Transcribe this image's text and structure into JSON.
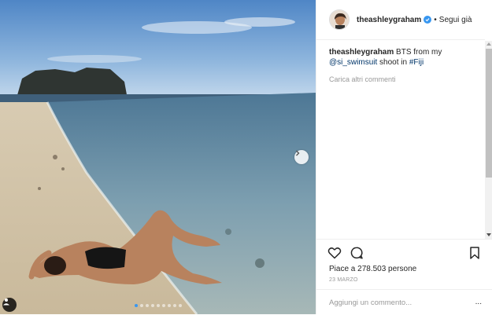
{
  "post": {
    "username": "theashleygraham",
    "separator": "•",
    "follow_label": "Segui già",
    "caption": {
      "username": "theashleygraham",
      "text_before": " BTS from my ",
      "mention": "@si_swimsuit",
      "text_middle": " shoot in ",
      "hashtag": "#Fiji"
    },
    "load_more_label": "Carica altri commenti",
    "likes_text": "Piace a 278.503 persone",
    "date_text": "23 MARZO",
    "comment_placeholder": "Aggiungi un commento...",
    "more_label": "...",
    "carousel": {
      "total": 9,
      "active": 1
    }
  },
  "icons": {
    "verified": "verified-badge-icon",
    "like": "heart-icon",
    "comment": "comment-bubble-icon",
    "save": "bookmark-icon",
    "next": "chevron-right-icon",
    "user_tag": "user-tag-icon"
  },
  "colors": {
    "accent_blue": "#3897f0",
    "link_blue": "#003569",
    "text": "#262626",
    "muted": "#999999",
    "border": "#efefef"
  }
}
